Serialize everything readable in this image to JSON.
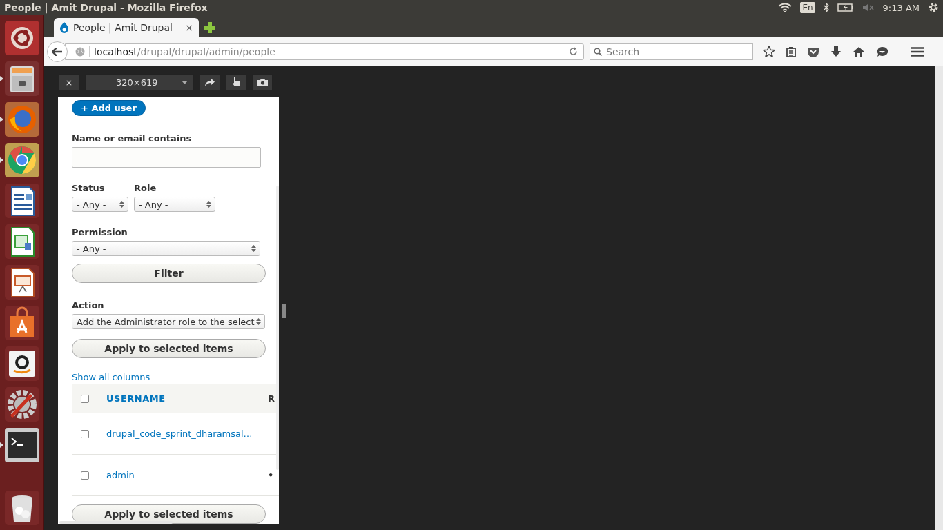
{
  "top_bar": {
    "title": "People | Amit Drupal - Mozilla Firefox",
    "keyboard": "En",
    "time": "9:13 AM"
  },
  "launcher": {
    "items": [
      {
        "kind": "ubuntu",
        "running": false
      },
      {
        "kind": "files",
        "running": true
      },
      {
        "kind": "firefox",
        "running": true
      },
      {
        "kind": "chrome",
        "running": true
      },
      {
        "kind": "writer",
        "running": false
      },
      {
        "kind": "calc",
        "running": false
      },
      {
        "kind": "impress",
        "running": false
      },
      {
        "kind": "software",
        "running": false
      },
      {
        "kind": "amazon",
        "running": false
      },
      {
        "kind": "settings",
        "running": false
      },
      {
        "kind": "terminal",
        "running": true
      },
      {
        "kind": "trash",
        "running": false
      }
    ]
  },
  "browser": {
    "tabs": [
      {
        "label": "People | Amit Drupal",
        "close": "×",
        "selected": true
      }
    ],
    "address": {
      "host": "localhost",
      "path": "/drupal/drupal/admin/people"
    },
    "search": {
      "placeholder": "Search"
    }
  },
  "responsive_toolbar": {
    "close": "×",
    "size": "320×619"
  },
  "page": {
    "add_button": "+ Add user",
    "filters": {
      "name_label": "Name or email contains",
      "status_label": "Status",
      "status_value": "- Any -",
      "role_label": "Role",
      "role_value": "- Any -",
      "permission_label": "Permission",
      "permission_value": "- Any -",
      "filter_button": "Filter"
    },
    "action_label": "Action",
    "action_value": "Add the Administrator role to the select",
    "apply_button": "Apply to selected items",
    "show_all_columns": "Show all columns",
    "table": {
      "select_all_checked": false,
      "columns": [
        "USERNAME",
        "R"
      ],
      "rows": [
        {
          "checked": false,
          "username": "drupal_code_sprint_dharamsal…"
        },
        {
          "checked": false,
          "username": "admin",
          "column_3": "•"
        }
      ]
    },
    "apply_button_bottom": "Apply to selected items"
  }
}
